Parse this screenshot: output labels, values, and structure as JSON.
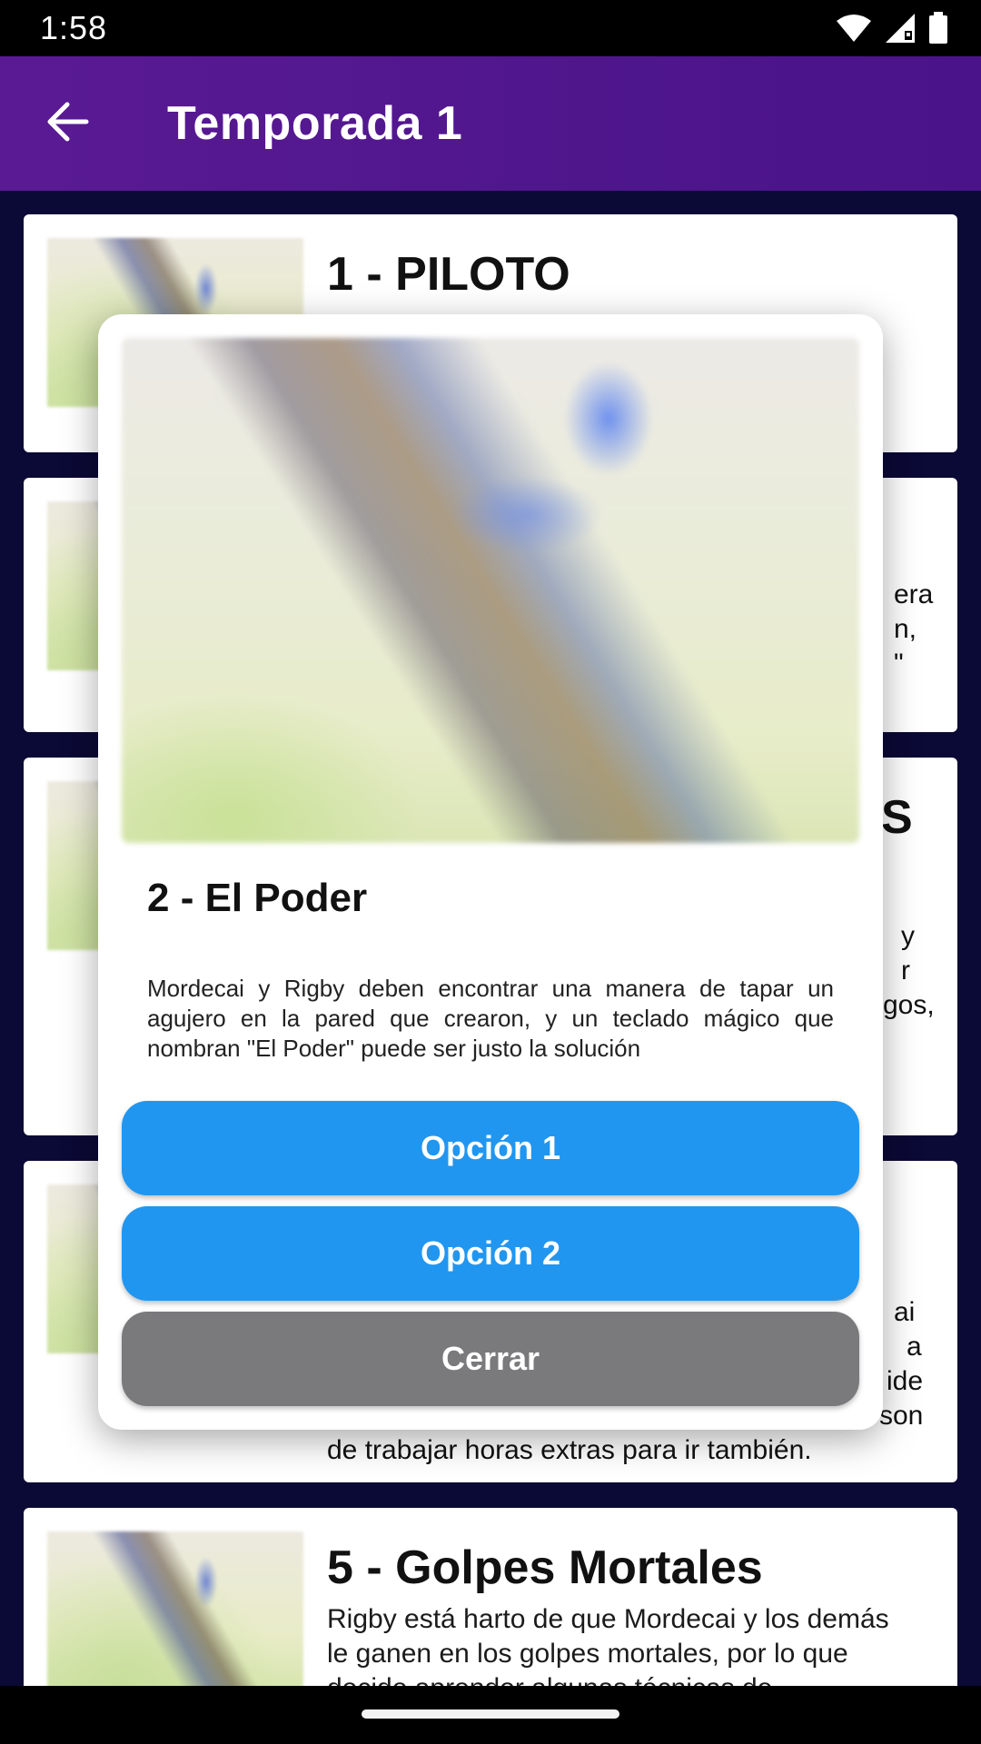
{
  "status_bar": {
    "time": "1:58"
  },
  "app_bar": {
    "title": "Temporada 1",
    "back_icon": "arrow-left-icon"
  },
  "episodes": [
    {
      "title": "1 - PILOTO",
      "description": ""
    },
    {
      "title": "",
      "description": ""
    },
    {
      "title": "",
      "description": ""
    },
    {
      "title": "",
      "description": ""
    },
    {
      "title": "5 - Golpes Mortales",
      "description": "Rigby está harto de que Mordecai y los demás le ganen en los golpes mortales, por lo que decide aprender algunas técnicas de"
    }
  ],
  "partial_text": {
    "card2_line1": "era",
    "card2_line2": "n,",
    "card2_line3": "\"",
    "card3_title_tail": "S",
    "card3_line1": "y",
    "card3_line2": "r",
    "card3_line3": "gos,",
    "card4_line1": "ai",
    "card4_line2": "a",
    "card4_line3": "ide",
    "card4_line4": "son",
    "card4_last_line": "de trabajar horas extras para ir también."
  },
  "dialog": {
    "title": "2 - El Poder",
    "description": "Mordecai y Rigby deben encontrar una manera de tapar un agujero en la pared que crearon, y un teclado mágico que nombran \"El Poder\" puede ser justo la solución",
    "option1_label": "Opción 1",
    "option2_label": "Opción 2",
    "close_label": "Cerrar"
  },
  "colors": {
    "app_bar": "#4f168c",
    "background": "#0b0935",
    "primary_button": "#2196f0",
    "close_button": "#7a797c"
  }
}
